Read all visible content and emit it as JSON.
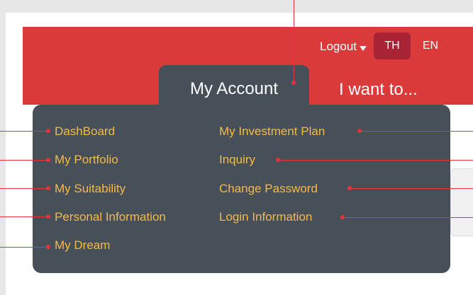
{
  "header": {
    "logout_label": "Logout",
    "languages": [
      "TH",
      "EN"
    ],
    "active_language": "TH",
    "colors": {
      "header_bg": "#db3a3a",
      "panel_bg": "#475059",
      "menu_text": "#f6ba44",
      "active_lang_bg": "#a82434"
    }
  },
  "nav": {
    "tabs": [
      {
        "label": "My Account",
        "active": true
      },
      {
        "label": "I want to...",
        "active": false
      }
    ]
  },
  "menu": {
    "left_items": [
      {
        "label": "DashBoard"
      },
      {
        "label": "My Portfolio"
      },
      {
        "label": "My Suitability"
      },
      {
        "label": "Personal Information"
      },
      {
        "label": "My Dream"
      }
    ],
    "right_items": [
      {
        "label": "My Investment Plan"
      },
      {
        "label": "Inquiry"
      },
      {
        "label": "Change Password"
      },
      {
        "label": "Login Information"
      }
    ]
  }
}
